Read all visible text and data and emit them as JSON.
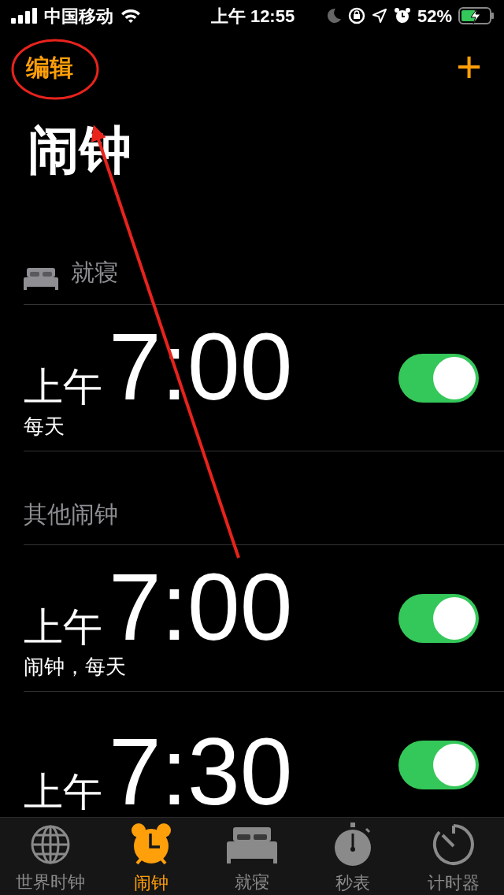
{
  "status_bar": {
    "carrier": "中国移动",
    "time": "上午 12:55",
    "battery": "52%"
  },
  "nav": {
    "edit": "编辑",
    "add": "+"
  },
  "title": "闹钟",
  "sections": [
    {
      "kind": "bedtime",
      "title": "就寝",
      "alarms": [
        {
          "period": "上午",
          "time": "7:00",
          "label": "每天",
          "on": true
        }
      ]
    },
    {
      "kind": "other",
      "title": "其他闹钟",
      "alarms": [
        {
          "period": "上午",
          "time": "7:00",
          "label": "闹钟，每天",
          "on": true
        },
        {
          "period": "上午",
          "time": "7:30",
          "on": true
        }
      ]
    }
  ],
  "tabs": [
    {
      "label": "世界时钟",
      "selected": false
    },
    {
      "label": "闹钟",
      "selected": true
    },
    {
      "label": "就寝",
      "selected": false
    },
    {
      "label": "秒表",
      "selected": false
    },
    {
      "label": "计时器",
      "selected": false
    }
  ],
  "annotations": {
    "ellipse": true,
    "arrow": true
  }
}
